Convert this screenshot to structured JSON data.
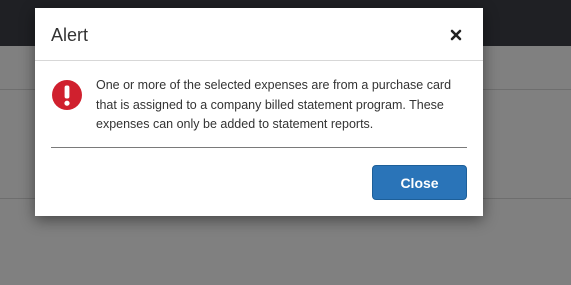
{
  "modal": {
    "title": "Alert",
    "message": "One or more of the selected expenses are from a purchase card that is assigned to a company billed statement program. These expenses can only be added to statement reports.",
    "close_button_label": "Close",
    "close_icon": "close-x-icon",
    "alert_icon": "exclamation-circle-icon"
  },
  "colors": {
    "primary_button": "#2a74b8",
    "alert_icon": "#d0202e",
    "overlay": "#7f7f7f",
    "top_bar": "#1f2024"
  }
}
